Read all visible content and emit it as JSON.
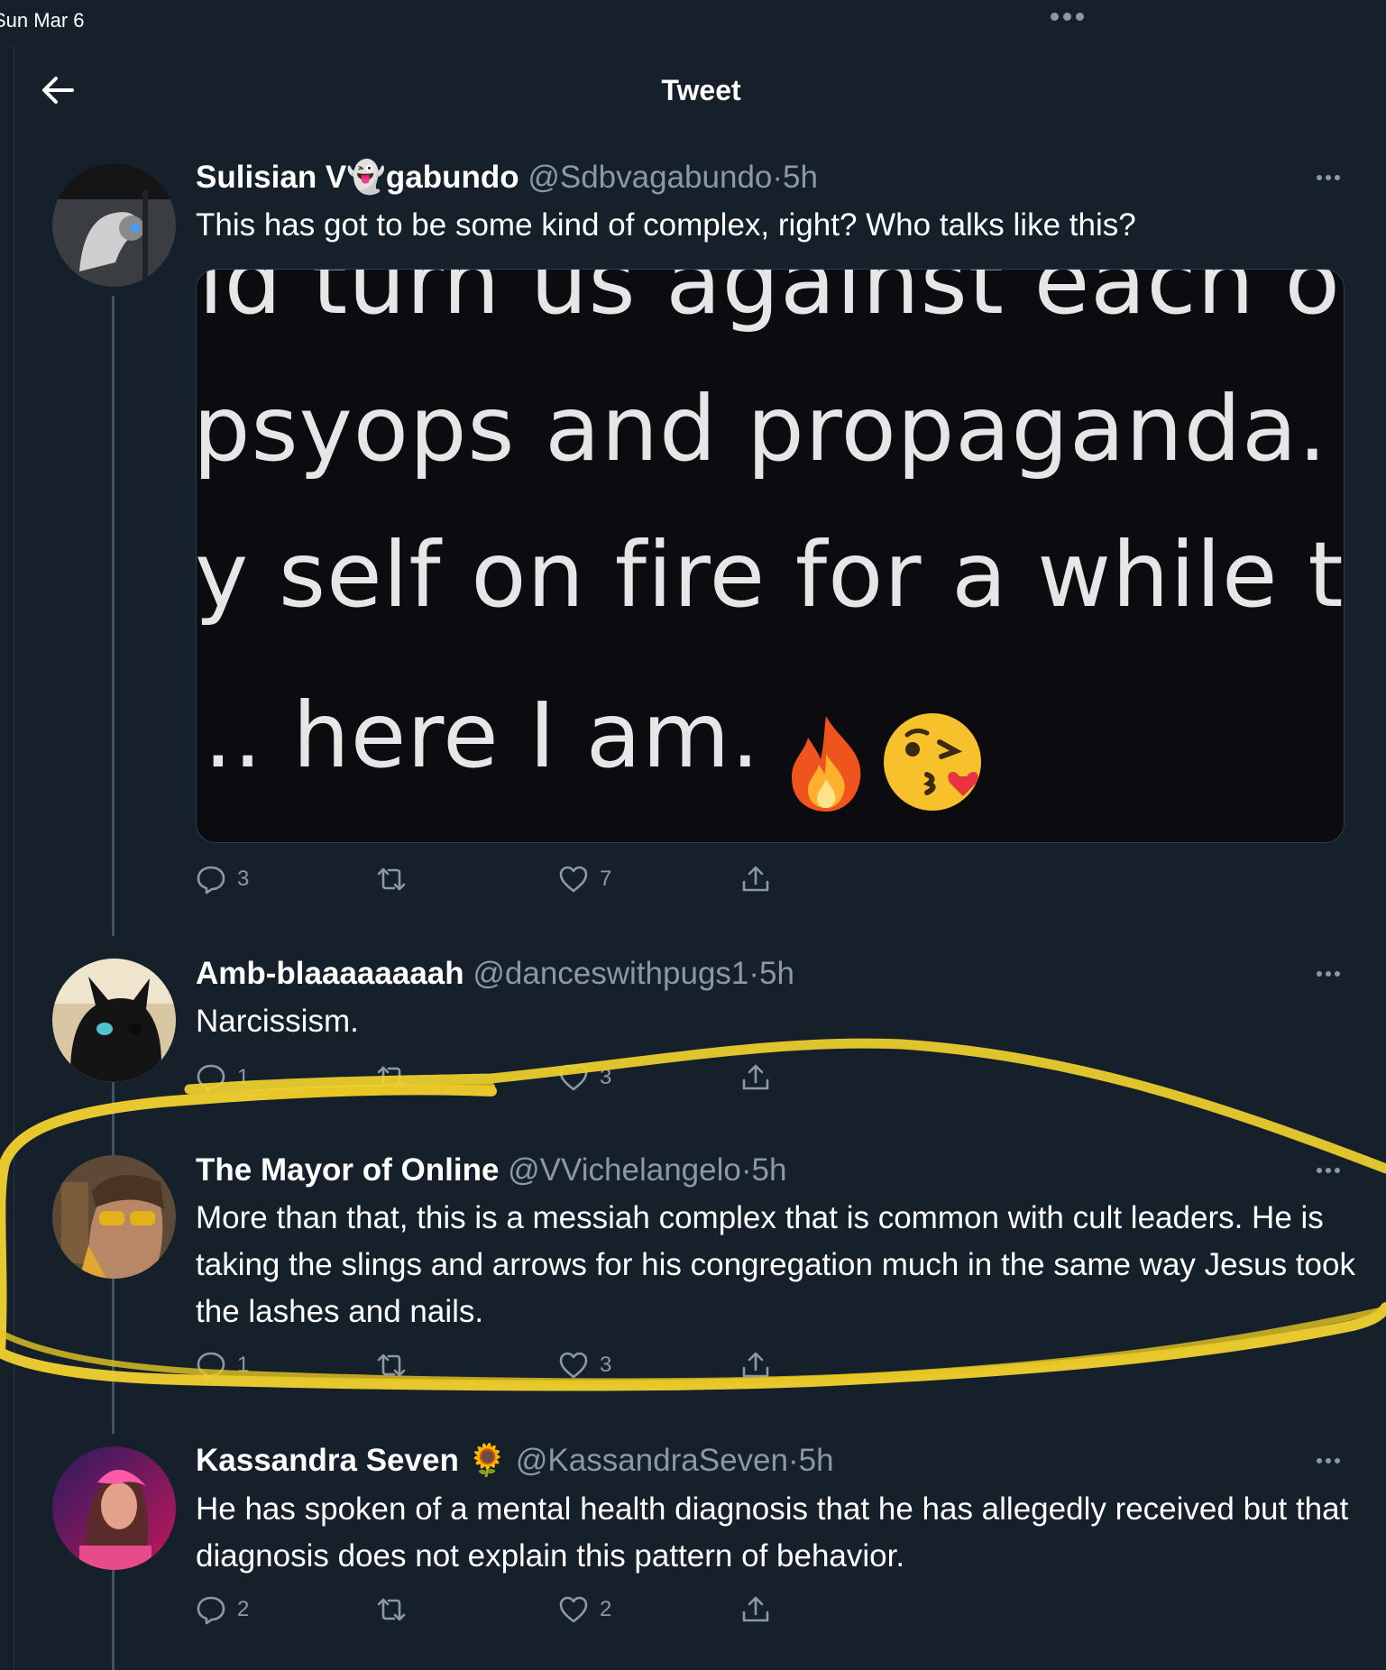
{
  "status_bar": {
    "time": "Sun Mar 6"
  },
  "header": {
    "title": "Tweet"
  },
  "tweets": [
    {
      "name": "Sulisian V👻gabundo",
      "handle": "@Sdbvagabundo",
      "separator": "·",
      "time": "5h",
      "text": "This has got to be some kind of complex, right? Who talks like this?",
      "media_lines": [
        "ld turn us against each oth",
        "psyops and propaganda. If",
        "y self on fire for a while to g",
        ".. here I am."
      ],
      "media_emojis": [
        "fire",
        "kissing-face-with-heart"
      ],
      "replies": "3",
      "retweets": "",
      "likes": "7"
    },
    {
      "name": "Amb-blaaaaaaaah",
      "handle": "@danceswithpugs1",
      "separator": "·",
      "time": "5h",
      "text": "Narcissism.",
      "replies": "1",
      "retweets": "",
      "likes": "3"
    },
    {
      "name": "The Mayor of Online",
      "handle": "@VVichelangelo",
      "separator": "·",
      "time": "5h",
      "text": "More than that, this is a messiah complex that is common with cult leaders. He is taking the slings and arrows for his congregation much in the same way Jesus took the lashes and nails.",
      "replies": "1",
      "retweets": "",
      "likes": "3"
    },
    {
      "name": "Kassandra Seven 🌻",
      "handle": "@KassandraSeven",
      "separator": "·",
      "time": "5h",
      "text": "He has spoken of a mental health diagnosis that he has allegedly received but that diagnosis does not explain this pattern of behavior.",
      "replies": "2",
      "retweets": "",
      "likes": "2"
    }
  ],
  "colors": {
    "background": "#15202b",
    "secondary_text": "#8b98a5",
    "highlight_scribble": "#f2d22e"
  }
}
